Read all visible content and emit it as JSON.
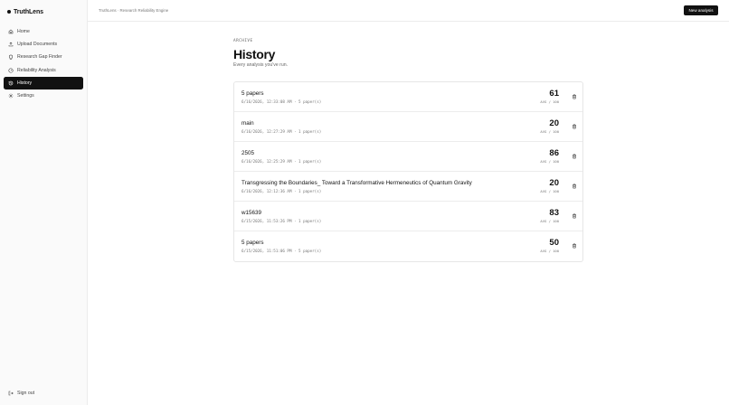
{
  "app": {
    "name": "TruthLens"
  },
  "sidebar": {
    "items": [
      {
        "label": "Home",
        "icon": "home-icon",
        "active": false
      },
      {
        "label": "Upload Documents",
        "icon": "upload-icon",
        "active": false
      },
      {
        "label": "Research Gap Finder",
        "icon": "lightbulb-icon",
        "active": false
      },
      {
        "label": "Reliability Analysis",
        "icon": "gauge-icon",
        "active": false
      },
      {
        "label": "History",
        "icon": "history-icon",
        "active": true
      },
      {
        "label": "Settings",
        "icon": "gear-icon",
        "active": false
      }
    ],
    "signout_label": "Sign out"
  },
  "header": {
    "breadcrumb": "TruthLens · Research Reliability Engine",
    "new_button_label": "New analysis"
  },
  "page": {
    "eyebrow": "ARCHIVE",
    "title": "History",
    "subtitle": "Every analysis you've run."
  },
  "analyses": [
    {
      "title": "5 papers",
      "meta": "6/16/2026, 12:33:08 AM · 5 paper(s)",
      "score": "61",
      "score_label": "AVG / 100"
    },
    {
      "title": "main",
      "meta": "6/16/2026, 12:27:29 AM · 1 paper(s)",
      "score": "20",
      "score_label": "AVG / 100"
    },
    {
      "title": "2505",
      "meta": "6/16/2026, 12:25:29 AM · 1 paper(s)",
      "score": "86",
      "score_label": "AVG / 100"
    },
    {
      "title": "Transgressing the Boundaries_ Toward a Transformative Hermeneutics of Quantum Gravity",
      "meta": "6/16/2026, 12:12:36 AM · 1 paper(s)",
      "score": "20",
      "score_label": "AVG / 100"
    },
    {
      "title": "w15639",
      "meta": "6/15/2026, 11:53:26 PM · 1 paper(s)",
      "score": "83",
      "score_label": "AVG / 100"
    },
    {
      "title": "5 papers",
      "meta": "6/15/2026, 11:51:06 PM · 5 paper(s)",
      "score": "50",
      "score_label": "AVG / 100"
    }
  ],
  "colors": {
    "accent": "#111111",
    "sidebar_bg": "#fafafa",
    "border": "#ececec"
  }
}
